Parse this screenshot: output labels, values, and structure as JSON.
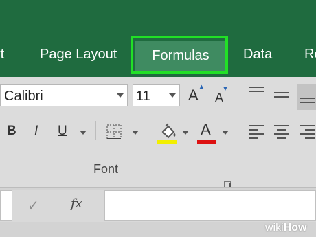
{
  "tabs": {
    "cut_left": "rt",
    "page_layout": "Page Layout",
    "formulas": "Formulas",
    "data": "Data",
    "review_partial": "Re"
  },
  "font": {
    "name": "Calibri",
    "size": "11",
    "grow_label": "A",
    "shrink_label": "A",
    "bold": "B",
    "italic": "I",
    "underline": "U",
    "font_color_label": "A",
    "group_label": "Font"
  },
  "formula_bar": {
    "enter_symbol": "✓",
    "fx_label": "fx",
    "value": ""
  },
  "watermark": {
    "part1": "wiki",
    "part2": "How"
  },
  "colors": {
    "tab_bar": "#1f6b3f",
    "active_tab": "#3f8b61",
    "highlight": "#21e026",
    "fill_color": "#f2ef00",
    "font_color": "#dd1111"
  }
}
